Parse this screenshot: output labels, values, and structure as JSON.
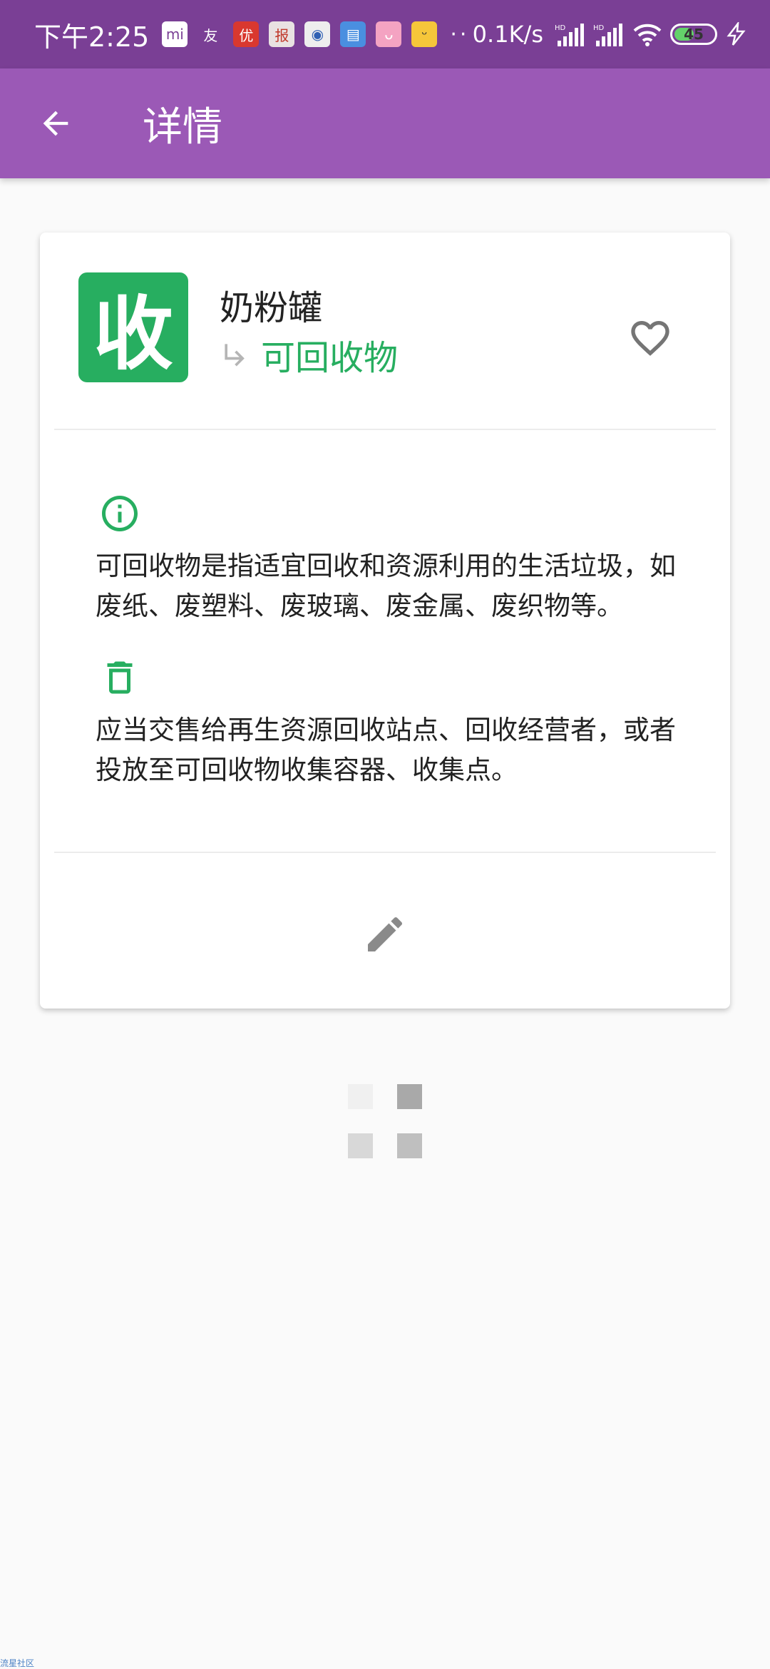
{
  "status_bar": {
    "time": "下午2:25",
    "notification_icons": [
      {
        "name": "mi-store-icon",
        "glyph": "mi",
        "color": "#ffffff",
        "text_color": "#7a3f95"
      },
      {
        "name": "friend-app-icon",
        "glyph": "友",
        "color": "transparent",
        "text_color": "#ffffff"
      },
      {
        "name": "app-red-icon",
        "glyph": "优",
        "color": "#d9382f",
        "text_color": "#ffffff"
      },
      {
        "name": "app-news-icon",
        "glyph": "报",
        "color": "#e9e2e2",
        "text_color": "#c0392b"
      },
      {
        "name": "app-blue-icon",
        "glyph": "◉",
        "color": "#eeeeee",
        "text_color": "#3061b3"
      },
      {
        "name": "app-folder-icon",
        "glyph": "▤",
        "color": "#4a8fe0",
        "text_color": "#ffffff"
      },
      {
        "name": "bilibili-icon",
        "glyph": "ᴗ",
        "color": "#f4a3c2",
        "text_color": "#ffffff"
      },
      {
        "name": "app-yellow-icon",
        "glyph": "ᵕ",
        "color": "#f6c63a",
        "text_color": "#333333"
      }
    ],
    "dots": "··",
    "net_speed": "0.1K/s",
    "battery_level": "45"
  },
  "app_bar": {
    "title": "详情"
  },
  "item": {
    "badge_char": "收",
    "name": "奶粉罐",
    "category": "可回收物",
    "accent_color": "#27ae60"
  },
  "info": {
    "definition": "可回收物是指适宜回收和资源利用的生活垃圾，如废纸、废塑料、废玻璃、废金属、废织物等。",
    "disposal": "应当交售给再生资源回收站点、回收经营者，或者投放至可回收物收集容器、收集点。"
  },
  "watermark": "流星社区"
}
